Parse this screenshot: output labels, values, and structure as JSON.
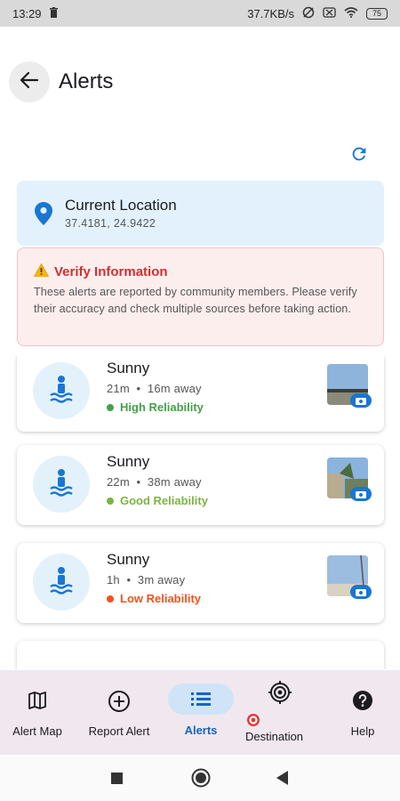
{
  "status_bar": {
    "time": "13:29",
    "network_speed": "37.7KB/s",
    "battery": "75"
  },
  "header": {
    "title": "Alerts"
  },
  "location": {
    "title": "Current Location",
    "coords": "37.4181, 24.9422"
  },
  "verify": {
    "title": "Verify Information",
    "text": "These alerts are reported by community members. Please verify their accuracy and check multiple sources before taking action."
  },
  "alerts": [
    {
      "title": "Sunny",
      "age": "21m",
      "distance": "16m away",
      "reliability": "High Reliability",
      "reliability_color": "#43a047"
    },
    {
      "title": "Sunny",
      "age": "22m",
      "distance": "38m away",
      "reliability": "Good Reliability",
      "reliability_color": "#7cb342"
    },
    {
      "title": "Sunny",
      "age": "1h",
      "distance": "3m away",
      "reliability": "Low Reliability",
      "reliability_color": "#f4511e"
    }
  ],
  "meta_separator": "•",
  "nav": {
    "items": [
      {
        "label": "Alert Map",
        "icon": "map-icon"
      },
      {
        "label": "Report Alert",
        "icon": "add-circle-icon"
      },
      {
        "label": "Alerts",
        "icon": "list-icon",
        "active": true
      },
      {
        "label": "Destination",
        "icon": "target-icon"
      },
      {
        "label": "Help",
        "icon": "help-icon"
      }
    ]
  },
  "colors": {
    "accent": "#1976d2",
    "danger": "#d32f2f",
    "nav_background": "#f1e7ef",
    "active_pill": "#cfe4f7"
  }
}
